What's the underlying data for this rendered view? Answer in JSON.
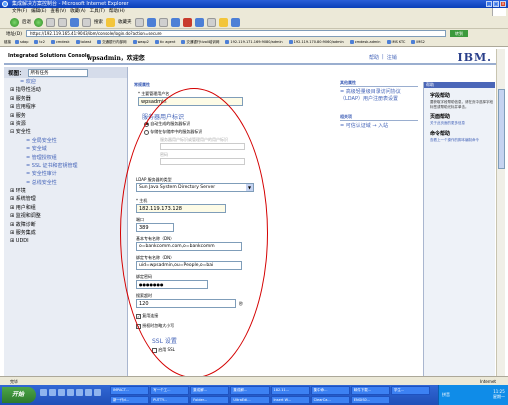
{
  "window": {
    "title": "集成解决方案控制台 - Microsoft Internet Explorer"
  },
  "menu": [
    "文件(F)",
    "编辑(E)",
    "查看(V)",
    "收藏(A)",
    "工具(T)",
    "帮助(H)"
  ],
  "toolbar": {
    "back": "后退",
    "search": "搜索",
    "favorites": "收藏夹"
  },
  "address": {
    "label": "地址(D)",
    "url": "https://192.119.165.41:9043/ibm/console/login.do?action=secure",
    "go": "转到"
  },
  "links_bar": [
    "链接",
    "sdap",
    "tc2",
    "cmdesk",
    "tolwst",
    "交通银行内部网",
    "wasp2",
    "tic agent",
    "交通银行tivoli培训网",
    "192.119.171.169:9080/admin",
    "192.119.170.80:9060/admin",
    "cmdesk-admin",
    "IMS KTC",
    "IMS2"
  ],
  "console": {
    "product": "Integrated Solutions Console",
    "welcome": "wpsadmin，欢迎您",
    "help": "帮助",
    "logout": "注销",
    "ibm": "IBM."
  },
  "nav": {
    "view_label": "视图：",
    "view_value": "所有任务",
    "items": [
      {
        "label": "= 欢迎",
        "kind": "lnk"
      },
      {
        "label": "⊞ 指导性活动",
        "kind": "top"
      },
      {
        "label": "⊞ 服务器",
        "kind": "top"
      },
      {
        "label": "⊞ 应用程序",
        "kind": "top"
      },
      {
        "label": "⊞ 服务",
        "kind": "top"
      },
      {
        "label": "⊞ 资源",
        "kind": "top"
      },
      {
        "label": "⊟ 安全性",
        "kind": "top"
      },
      {
        "label": "= 全局安全性",
        "kind": "sub"
      },
      {
        "label": "= 安全域",
        "kind": "sub"
      },
      {
        "label": "= 管理授权组",
        "kind": "sub"
      },
      {
        "label": "= SSL 证书和密钥管理",
        "kind": "sub"
      },
      {
        "label": "= 安全性审计",
        "kind": "sub"
      },
      {
        "label": "= 总线安全性",
        "kind": "sub"
      },
      {
        "label": "⊞ 环境",
        "kind": "top"
      },
      {
        "label": "⊞ 系统管理",
        "kind": "top"
      },
      {
        "label": "⊞ 用户和组",
        "kind": "top"
      },
      {
        "label": "⊞ 监视和调整",
        "kind": "top"
      },
      {
        "label": "⊞ 故障诊断",
        "kind": "top"
      },
      {
        "label": "⊞ 服务集成",
        "kind": "top"
      },
      {
        "label": "⊞ UDDI",
        "kind": "top"
      }
    ]
  },
  "form": {
    "top_title": "常规属性",
    "admin_label": "* 主要管理用户名",
    "admin_value": "wpsadmin",
    "server_identity_title": "服务器用户标识",
    "radio_auto": "自动生成的服务器标识",
    "radio_stored": "存储在存储库中的服务器标识",
    "stored_hint": "服务器用户标识或管理用户的用户标识",
    "password_field_label": "密码",
    "ldap_type_label": "LDAP 服务器的类型",
    "ldap_type_value": "Sun Java System Directory Server",
    "host_label": "* 主机",
    "host_value": "182.119.173.128",
    "port_label": "端口",
    "port_value": "389",
    "base_dn_label": "基本专有名称（DN）",
    "base_dn_value": "o=bankcomm.com,o=bankcomm",
    "bind_dn_label": "绑定专有名称（DN）",
    "bind_dn_value": "uid=wpsadmin,ou=People,o=bai",
    "bind_pwd_label": "绑定密码",
    "bind_pwd_value": "●●●●●●●",
    "timeout_label": "搜索超时",
    "timeout_value": "120",
    "timeout_unit": "秒",
    "reuse_conn": "复用连接",
    "ignore_case": "授权时忽略大小写",
    "ssl_title": "SSL 设置",
    "ssl_enable": "启用 SSL"
  },
  "related": {
    "other_props_title": "其他属性",
    "other_props_link": "高级轻量级目录访问协议（LDAP）用户注册表设置",
    "related_items_title": "相关项",
    "related_link": "可信认证域 → 入站"
  },
  "help": {
    "bar": "帮助",
    "field_help_title": "字段帮助",
    "field_help_text": "要获取字段帮助信息，请在页中选择字段标签或帮助光标并单击。",
    "page_help_title": "页面帮助",
    "page_help_link": "关于此页面的更多信息",
    "cmd_help_title": "命令帮助",
    "cmd_help_link": "查看上一个操作的脚本编制命令"
  },
  "status": {
    "left": "完毕",
    "zone": "Internet"
  },
  "taskbar": {
    "start": "开始",
    "tasks": [
      "IMPACT...",
      "写一个工...",
      "集成解...",
      "集成解...",
      "182.11...",
      "集中命...",
      "邮件下载...",
      "学生...",
      "新一代d...",
      "PUTTY...",
      "Folder...",
      "UltraEdi...",
      "Insert W...",
      "ClearCa...",
      "ENGIS0..."
    ],
    "ime": "拼音",
    "time": "11:25",
    "day": "星期一"
  },
  "colors": {
    "link": "#4363b8",
    "annotation": "#d40000"
  }
}
